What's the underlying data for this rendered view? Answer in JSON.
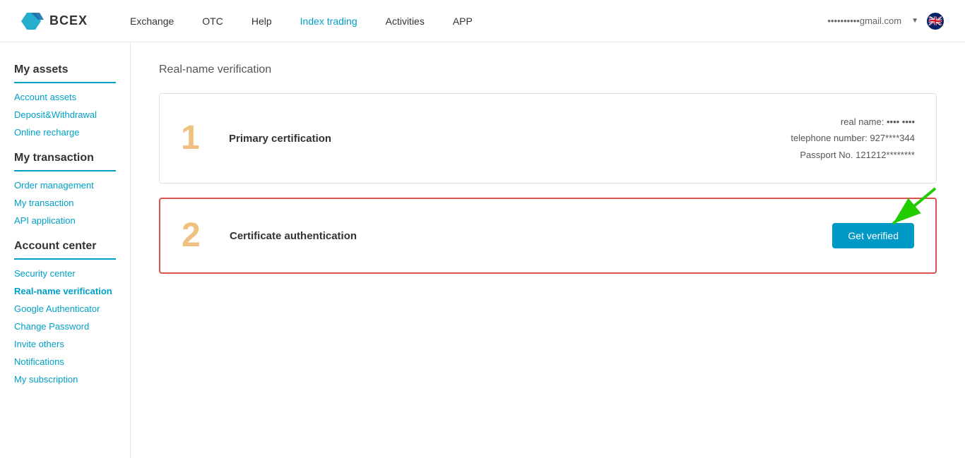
{
  "header": {
    "logo_text": "BCEX",
    "nav_items": [
      {
        "label": "Exchange",
        "active": false
      },
      {
        "label": "OTC",
        "active": false
      },
      {
        "label": "Help",
        "active": false
      },
      {
        "label": "Index trading",
        "active": true
      },
      {
        "label": "Activities",
        "active": false
      },
      {
        "label": "APP",
        "active": false
      }
    ],
    "user_email": "••••••••••gmail.com",
    "flag": "🇬🇧"
  },
  "sidebar": {
    "section1_title": "My assets",
    "section1_items": [
      {
        "label": "Account assets"
      },
      {
        "label": "Deposit&Withdrawal"
      },
      {
        "label": "Online recharge"
      }
    ],
    "section2_title": "My transaction",
    "section2_items": [
      {
        "label": "Order management"
      },
      {
        "label": "My transaction"
      },
      {
        "label": "API application"
      }
    ],
    "section3_title": "Account center",
    "section3_items": [
      {
        "label": "Security center"
      },
      {
        "label": "Real-name verification"
      },
      {
        "label": "Google Authenticator"
      },
      {
        "label": "Change Password"
      },
      {
        "label": "Invite others"
      },
      {
        "label": "Notifications"
      },
      {
        "label": "My subscription"
      }
    ]
  },
  "content": {
    "page_title": "Real-name verification",
    "card1": {
      "step": "1",
      "title": "Primary certification",
      "real_name_label": "real name:",
      "real_name_value": "•••• ••••",
      "telephone_label": "telephone number:",
      "telephone_value": "927****344",
      "passport_label": "Passport No.",
      "passport_value": "121212********"
    },
    "card2": {
      "step": "2",
      "title": "Certificate authentication",
      "btn_label": "Get verified"
    }
  }
}
